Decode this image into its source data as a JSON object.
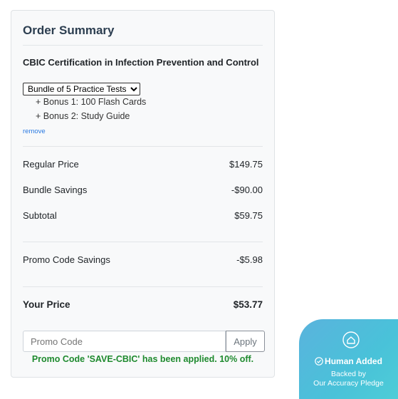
{
  "summary": {
    "title": "Order Summary",
    "product_name": "CBIC Certification in Infection Prevention and Control",
    "bundle_select": {
      "selected": "Bundle of 5 Practice Tests"
    },
    "bonuses": [
      "+ Bonus 1: 100 Flash Cards",
      "+ Bonus 2: Study Guide"
    ],
    "remove_label": "remove",
    "regular_price": {
      "label": "Regular Price",
      "value": "$149.75"
    },
    "bundle_savings": {
      "label": "Bundle Savings",
      "value": "-$90.00"
    },
    "subtotal": {
      "label": "Subtotal",
      "value": "$59.75"
    },
    "promo_savings": {
      "label": "Promo Code Savings",
      "value": "-$5.98"
    },
    "your_price": {
      "label": "Your Price",
      "value": "$53.77"
    },
    "promo": {
      "placeholder": "Promo Code",
      "apply_label": "Apply",
      "message": "Promo Code 'SAVE-CBIC' has been applied. 10% off."
    }
  },
  "badge": {
    "title": "Human Added",
    "line1": "Backed by",
    "line2": "Our Accuracy Pledge",
    "icon": "home-icon",
    "check_icon": "check-circle-icon"
  },
  "colors": {
    "promo_success": "#1e8a2e",
    "link": "#2a7ae2",
    "badge_gradient_start": "#5ab3dd",
    "badge_gradient_end": "#4fd0d6"
  }
}
